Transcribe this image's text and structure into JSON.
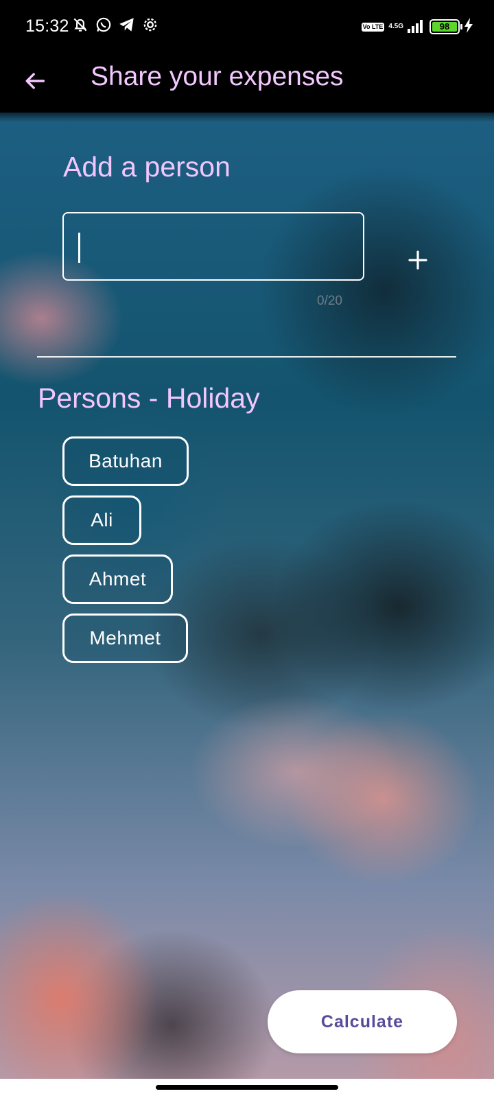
{
  "status_bar": {
    "time": "15:32",
    "network": "4.5G",
    "volte": "Vo LTE",
    "battery": "98",
    "icons": [
      "bell-off-icon",
      "whatsapp-icon",
      "telegram-icon",
      "settings-icon",
      "signal-icon",
      "battery-icon",
      "charging-icon"
    ]
  },
  "app_bar": {
    "back_icon": "arrow-left-icon",
    "title": "Share your expenses"
  },
  "add_section": {
    "title": "Add a person",
    "input_value": "",
    "counter": "0/20",
    "add_icon": "plus-icon"
  },
  "persons_section": {
    "title": "Persons - Holiday",
    "persons": [
      "Batuhan",
      "Ali",
      "Ahmet",
      "Mehmet"
    ]
  },
  "actions": {
    "calculate_label": "Calculate"
  },
  "colors": {
    "title_accent": "#f3c6ff",
    "button_text": "#5a4a9a"
  }
}
